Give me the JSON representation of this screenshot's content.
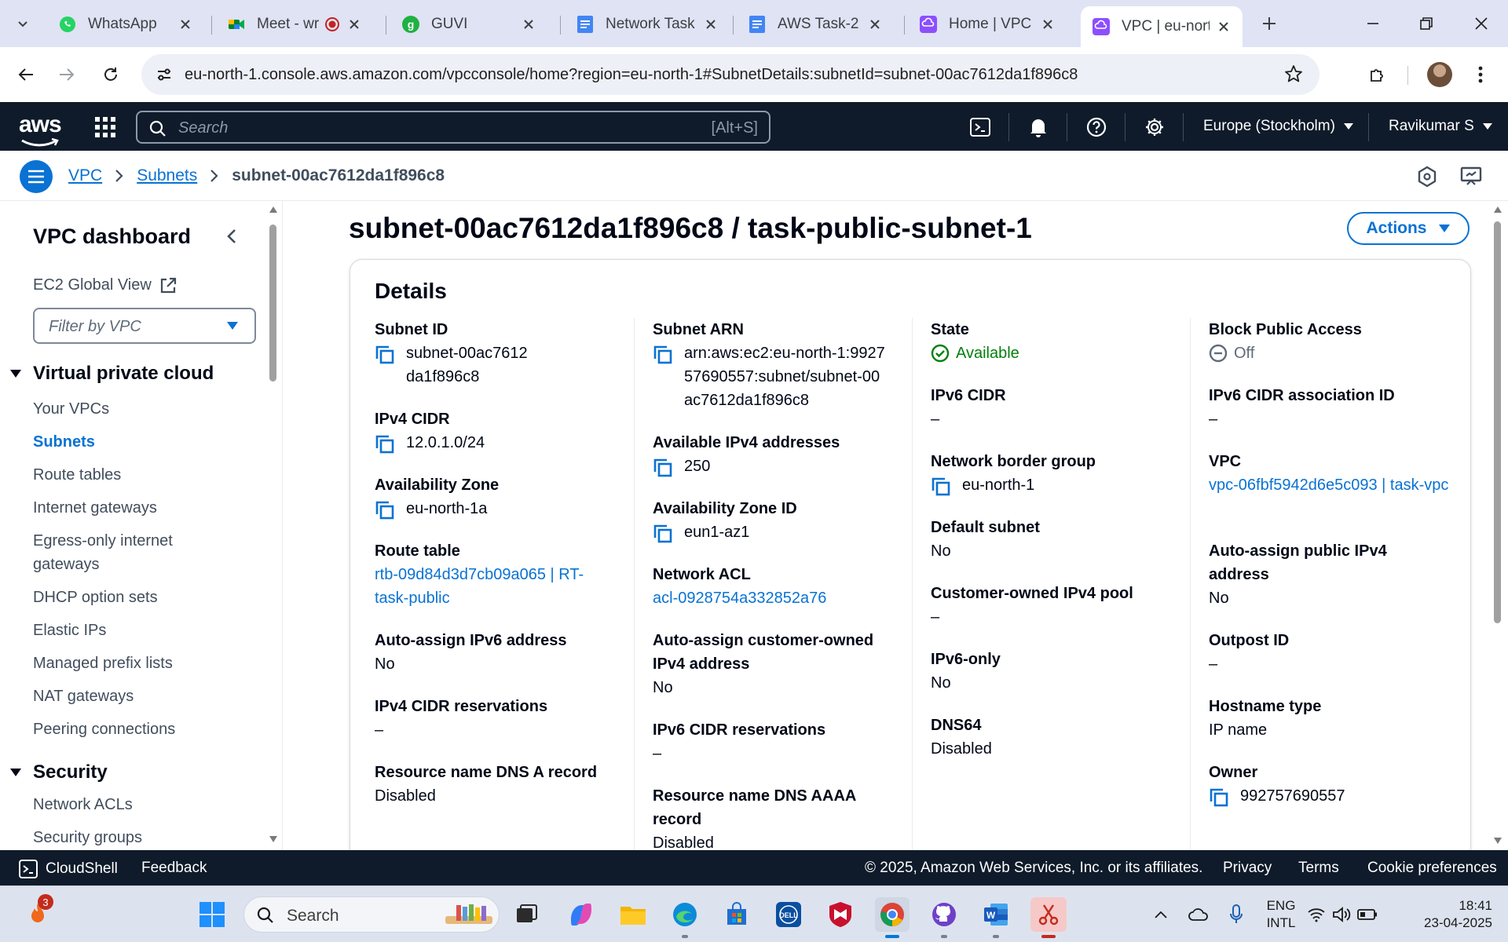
{
  "browser": {
    "tabs": [
      {
        "title": "WhatsApp",
        "icon": "whatsapp-icon"
      },
      {
        "title": "Meet - wr",
        "icon": "google-meet-icon"
      },
      {
        "title": "GUVI",
        "icon": "guvi-icon"
      },
      {
        "title": "Network Task",
        "icon": "google-docs-icon"
      },
      {
        "title": "AWS Task-2 - ",
        "icon": "google-docs-icon"
      },
      {
        "title": "Home | VPC | ",
        "icon": "aws-vpc-icon"
      },
      {
        "title": "VPC | eu-north",
        "icon": "aws-vpc-icon"
      }
    ],
    "url": "eu-north-1.console.aws.amazon.com/vpcconsole/home?region=eu-north-1#SubnetDetails:subnetId=subnet-00ac7612da1f896c8"
  },
  "aws_nav": {
    "logo": "aws",
    "search_placeholder": "Search",
    "search_shortcut": "[Alt+S]",
    "region": "Europe (Stockholm)",
    "user": "Ravikumar S"
  },
  "breadcrumb": {
    "items": [
      "VPC",
      "Subnets"
    ],
    "current": "subnet-00ac7612da1f896c8"
  },
  "sidebar": {
    "title": "VPC dashboard",
    "ec2_global_view": "EC2 Global View",
    "filter_placeholder": "Filter by VPC",
    "section_vpc": "Virtual private cloud",
    "vpc_items": [
      "Your VPCs",
      "Subnets",
      "Route tables",
      "Internet gateways",
      "Egress-only internet gateways",
      "DHCP option sets",
      "Elastic IPs",
      "Managed prefix lists",
      "NAT gateways",
      "Peering connections"
    ],
    "section_security": "Security",
    "security_items": [
      "Network ACLs",
      "Security groups"
    ]
  },
  "page": {
    "title": "subnet-00ac7612da1f896c8 / task-public-subnet-1",
    "actions_label": "Actions",
    "details_heading": "Details"
  },
  "details": {
    "subnet_id": {
      "label": "Subnet ID",
      "value": "subnet-00ac7612da1f896c8"
    },
    "ipv4_cidr": {
      "label": "IPv4 CIDR",
      "value": "12.0.1.0/24"
    },
    "availability_zone": {
      "label": "Availability Zone",
      "value": "eu-north-1a"
    },
    "route_table": {
      "label": "Route table",
      "value": "rtb-09d84d3d7cb09a065 | RT-task-public"
    },
    "auto_assign_ipv6": {
      "label": "Auto-assign IPv6 address",
      "value": "No"
    },
    "ipv4_cidr_reservations": {
      "label": "IPv4 CIDR reservations",
      "value": "–"
    },
    "resource_dns_a": {
      "label": "Resource name DNS A record",
      "value": "Disabled"
    },
    "subnet_arn": {
      "label": "Subnet ARN",
      "value": "arn:aws:ec2:eu-north-1:992757690557:subnet/subnet-00ac7612da1f896c8"
    },
    "available_ipv4": {
      "label": "Available IPv4 addresses",
      "value": "250"
    },
    "az_id": {
      "label": "Availability Zone ID",
      "value": "eun1-az1"
    },
    "network_acl": {
      "label": "Network ACL",
      "value": "acl-0928754a332852a76"
    },
    "auto_assign_customer_ipv4": {
      "label": "Auto-assign customer-owned IPv4 address",
      "value": "No"
    },
    "ipv6_cidr_reservations": {
      "label": "IPv6 CIDR reservations",
      "value": "–"
    },
    "resource_dns_aaaa": {
      "label": "Resource name DNS AAAA record",
      "value": "Disabled"
    },
    "state": {
      "label": "State",
      "value": "Available"
    },
    "ipv6_cidr": {
      "label": "IPv6 CIDR",
      "value": "–"
    },
    "network_border_group": {
      "label": "Network border group",
      "value": "eu-north-1"
    },
    "default_subnet": {
      "label": "Default subnet",
      "value": "No"
    },
    "customer_owned_ipv4_pool": {
      "label": "Customer-owned IPv4 pool",
      "value": "–"
    },
    "ipv6_only": {
      "label": "IPv6-only",
      "value": "No"
    },
    "dns64": {
      "label": "DNS64",
      "value": "Disabled"
    },
    "block_public_access": {
      "label": "Block Public Access",
      "value": "Off"
    },
    "ipv6_cidr_assoc_id": {
      "label": "IPv6 CIDR association ID",
      "value": "–"
    },
    "vpc": {
      "label": "VPC",
      "value": "vpc-06fbf5942d6e5c093 | task-vpc"
    },
    "auto_assign_public_ipv4": {
      "label": "Auto-assign public IPv4 address",
      "value": "No"
    },
    "outpost_id": {
      "label": "Outpost ID",
      "value": "–"
    },
    "hostname_type": {
      "label": "Hostname type",
      "value": "IP name"
    },
    "owner": {
      "label": "Owner",
      "value": "992757690557"
    }
  },
  "footer": {
    "cloudshell": "CloudShell",
    "feedback": "Feedback",
    "copyright": "© 2025, Amazon Web Services, Inc. or its affiliates.",
    "privacy": "Privacy",
    "terms": "Terms",
    "cookie": "Cookie preferences"
  },
  "taskbar": {
    "search_placeholder": "Search",
    "notification_count": "3",
    "lang_line1": "ENG",
    "lang_line2": "INTL",
    "time": "18:41",
    "date": "23-04-2025"
  },
  "colors": {
    "aws_nav_bg": "#0f1b2a",
    "link": "#0972d3",
    "success": "#037f0c",
    "tabstrip_bg": "#dfe3f4"
  }
}
